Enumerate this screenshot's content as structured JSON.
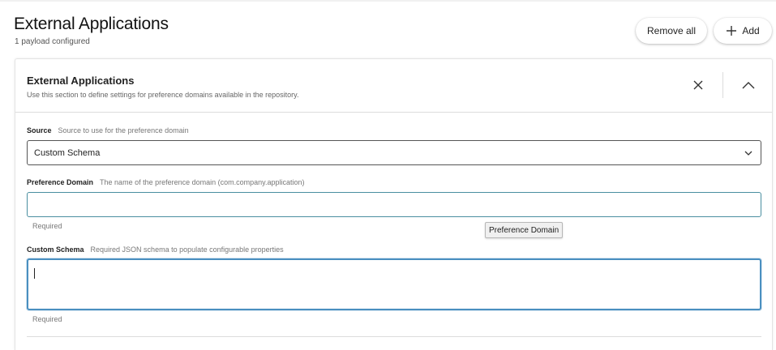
{
  "page": {
    "title": "External Applications",
    "subtitle": "1 payload configured"
  },
  "actions": {
    "remove_all_label": "Remove all",
    "add_label": "Add",
    "add_icon": "plus-icon"
  },
  "card": {
    "title": "External Applications",
    "description": "Use this section to define settings for preference domains available in the repository.",
    "close_icon": "close-icon",
    "collapse_icon": "chevron-up-icon"
  },
  "fields": {
    "source": {
      "label": "Source",
      "help": "Source to use for the preference domain",
      "selected": "Custom Schema",
      "icon": "chevron-down-icon"
    },
    "preference_domain": {
      "label": "Preference Domain",
      "help": "The name of the preference domain (com.company.application)",
      "value": "",
      "required_note": "Required"
    },
    "custom_schema": {
      "label": "Custom Schema",
      "help": "Required JSON schema to populate configurable properties",
      "value": "",
      "required_note": "Required"
    }
  },
  "tooltip": {
    "text": "Preference Domain"
  },
  "colors": {
    "focus_border": "#4a8fc0",
    "input_border": "#4a8fa0"
  }
}
